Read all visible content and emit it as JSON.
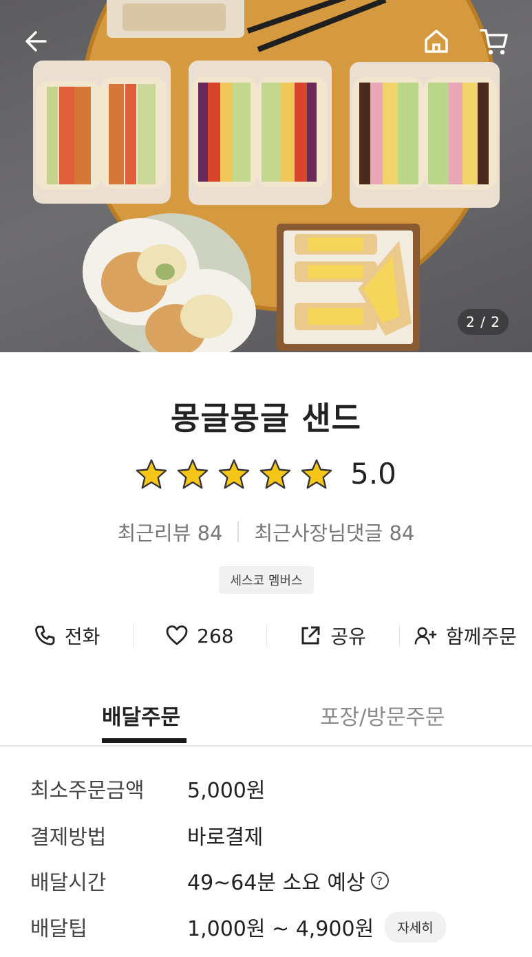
{
  "hero": {
    "back_icon": "back-arrow-icon",
    "home_icon": "home-icon",
    "cart_icon": "cart-icon",
    "pager": "2 / 2"
  },
  "store": {
    "name": "몽글몽글 샌드",
    "rating": 5.0,
    "rating_text": "5.0",
    "rating_max": 5,
    "reviews": "최근리뷰 84",
    "owner_replies": "최근사장님댓글 84",
    "badge": "세스코 멤버스"
  },
  "actions": [
    {
      "icon": "phone-icon",
      "label": "전화"
    },
    {
      "icon": "heart-icon",
      "label": "268"
    },
    {
      "icon": "share-icon",
      "label": "공유"
    },
    {
      "icon": "add-person-icon",
      "label": "함께주문"
    }
  ],
  "tabs": [
    {
      "label": "배달주문",
      "active": true
    },
    {
      "label": "포장/방문주문",
      "active": false
    }
  ],
  "info": [
    {
      "key": "최소주문금액",
      "value": "5,000원"
    },
    {
      "key": "결제방법",
      "value": "바로결제"
    },
    {
      "key": "배달시간",
      "value": "49~64분 소요 예상"
    },
    {
      "key": "배달팁",
      "value": "1,000원 ~ 4,900원",
      "button": "자세히"
    }
  ],
  "colors": {
    "star": "#f5c518",
    "text": "#222222",
    "muted": "#777777",
    "tab_underline": "#1a1a1a"
  }
}
